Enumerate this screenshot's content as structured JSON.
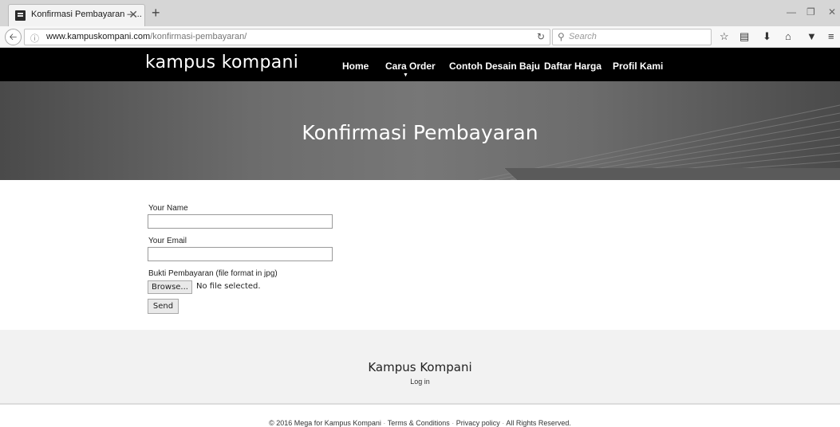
{
  "browser": {
    "tab_title": "Konfirmasi Pembayaran – ...",
    "tab_close": "✕",
    "new_tab": "+",
    "url_domain": "www.kampuskompani.com",
    "url_path": "/konfirmasi-pembayaran/",
    "search_placeholder": "Search",
    "icons": [
      "back-arrow-icon",
      "info-icon",
      "reload-icon",
      "search-icon",
      "bookmark-star-icon",
      "reading-list-icon",
      "download-icon",
      "home-icon",
      "pocket-icon",
      "menu-icon"
    ]
  },
  "site": {
    "logo": "kampus kompani",
    "nav": [
      {
        "label": "Home"
      },
      {
        "label": "Cara Order"
      },
      {
        "label": "Contoh Desain Baju"
      },
      {
        "label": "Daftar Harga"
      },
      {
        "label": "Profil Kami"
      }
    ]
  },
  "hero": {
    "title": "Konfirmasi Pembayaran"
  },
  "form": {
    "name_label": "Your Name",
    "name_value": "",
    "email_label": "Your Email",
    "email_value": "",
    "file_label": "Bukti Pembayaran (file format in jpg)",
    "browse_label": "Browse...",
    "file_status": "No file selected.",
    "send_label": "Send"
  },
  "footer": {
    "title": "Kampus Kompani",
    "login": "Log in",
    "copyright": "© 2016 Mega for Kampus Kompani",
    "terms": "Terms & Conditions",
    "privacy": "Privacy policy",
    "rights": "All Rights Reserved."
  }
}
